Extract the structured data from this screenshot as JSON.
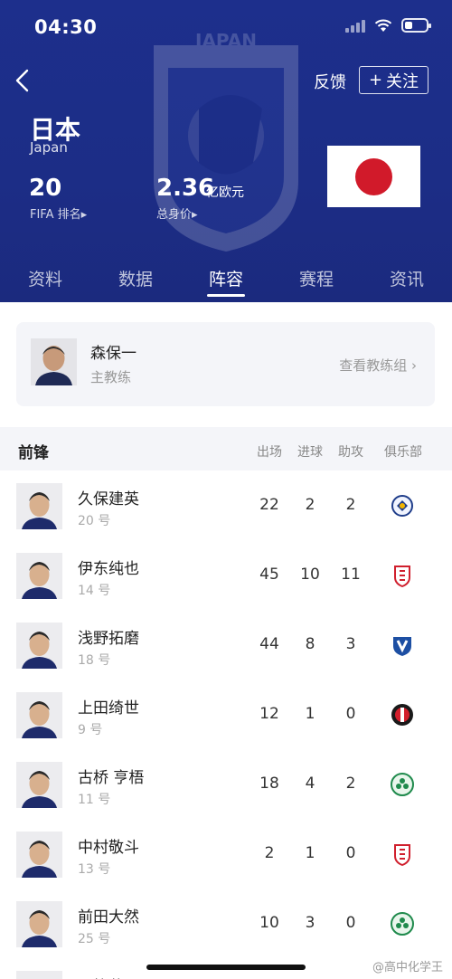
{
  "status_bar": {
    "time": "04:30",
    "battery_level": 0.35
  },
  "header": {
    "crest_text": "JAPAN",
    "feedback_label": "反馈",
    "follow_label": "关注",
    "follow_plus": "+",
    "team_name": "日本",
    "team_name_en": "Japan",
    "fifa_rank_value": "20",
    "fifa_rank_label": "FIFA 排名",
    "market_value": "2.36",
    "market_unit": "亿欧元",
    "market_label": "总身价",
    "caret": "▸"
  },
  "tabs": [
    {
      "label": "资料",
      "active": false
    },
    {
      "label": "数据",
      "active": false
    },
    {
      "label": "阵容",
      "active": true
    },
    {
      "label": "赛程",
      "active": false
    },
    {
      "label": "资讯",
      "active": false
    }
  ],
  "coach": {
    "name": "森保一",
    "role": "主教练",
    "link": "查看教练组 ›"
  },
  "roster": {
    "position": "前锋",
    "columns": [
      "出场",
      "进球",
      "助攻",
      "俱乐部"
    ],
    "players": [
      {
        "name": "久保建英",
        "number": "20 号",
        "apps": "22",
        "goals": "2",
        "assists": "2",
        "club_icon": "real-sociedad-crest"
      },
      {
        "name": "伊东纯也",
        "number": "14 号",
        "apps": "45",
        "goals": "10",
        "assists": "11",
        "club_icon": "stade-reims-crest"
      },
      {
        "name": "浅野拓磨",
        "number": "18 号",
        "apps": "44",
        "goals": "8",
        "assists": "3",
        "club_icon": "vfl-bochum-crest"
      },
      {
        "name": "上田绮世",
        "number": "9 号",
        "apps": "12",
        "goals": "1",
        "assists": "0",
        "club_icon": "feyenoord-crest"
      },
      {
        "name": "古桥 亨梧",
        "number": "11 号",
        "apps": "18",
        "goals": "4",
        "assists": "2",
        "club_icon": "celtic-crest"
      },
      {
        "name": "中村敬斗",
        "number": "13 号",
        "apps": "2",
        "goals": "1",
        "assists": "0",
        "club_icon": "stade-reims-crest"
      },
      {
        "name": "前田大然",
        "number": "25 号",
        "apps": "10",
        "goals": "3",
        "assists": "0",
        "club_icon": "celtic-crest"
      },
      {
        "name": "三笘薫",
        "number": "",
        "apps": "",
        "goals": "",
        "assists": "",
        "club_icon": ""
      }
    ]
  },
  "watermark": "@高中化学王",
  "colors": {
    "header_bg": "#1d2f8c",
    "flag_red": "#d11a2a",
    "section_bg": "#f4f5f9"
  }
}
